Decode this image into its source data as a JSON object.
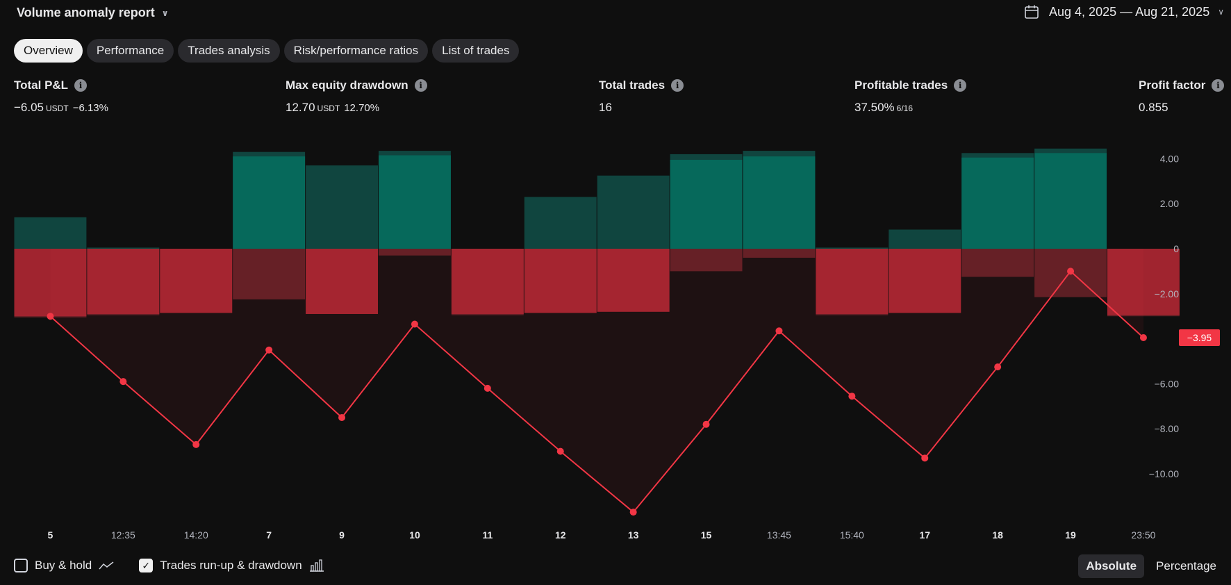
{
  "header": {
    "title": "Volume anomaly report",
    "date_range": "Aug 4, 2025 — Aug 21, 2025"
  },
  "tabs": [
    {
      "label": "Overview",
      "active": true
    },
    {
      "label": "Performance",
      "active": false
    },
    {
      "label": "Trades analysis",
      "active": false
    },
    {
      "label": "Risk/performance ratios",
      "active": false
    },
    {
      "label": "List of trades",
      "active": false
    }
  ],
  "metrics": {
    "total_pnl": {
      "label": "Total P&L",
      "value": "−6.05",
      "unit": "USDT",
      "pct": "−6.13%"
    },
    "max_drawdown": {
      "label": "Max equity drawdown",
      "value": "12.70",
      "unit": "USDT",
      "pct": "12.70%"
    },
    "total_trades": {
      "label": "Total trades",
      "value": "16"
    },
    "profitable": {
      "label": "Profitable trades",
      "value": "37.50%",
      "ratio": "6/16"
    },
    "profit_factor": {
      "label": "Profit factor",
      "value": "0.855"
    }
  },
  "colors": {
    "bg": "#0f0f0f",
    "negative": "#f23645",
    "runup_bright": "#06695b",
    "runup_dim": "#10453f",
    "drawdown_bright": "#a0242f",
    "drawdown_dim": "#5c1f24"
  },
  "chart_data": {
    "type": "line",
    "y_ticks": [
      "4.00",
      "2.00",
      "0",
      "−2.00",
      "−6.00",
      "−8.00",
      "−10.00"
    ],
    "y_tick_values": [
      4,
      2,
      0,
      -2,
      -6,
      -8,
      -10
    ],
    "ylim": [
      -12.7,
      5.0
    ],
    "categories": [
      "5",
      "12:35",
      "14:20",
      "7",
      "9",
      "10",
      "11",
      "12",
      "13",
      "15",
      "13:45",
      "15:40",
      "17",
      "18",
      "19",
      "23:50"
    ],
    "bold_categories": [
      "5",
      "7",
      "9",
      "10",
      "11",
      "12",
      "13",
      "15",
      "17",
      "18",
      "19"
    ],
    "equity": [
      -3.0,
      -5.9,
      -8.7,
      -4.5,
      -7.5,
      -3.35,
      -6.2,
      -9.0,
      -11.7,
      -7.8,
      -3.65,
      -6.55,
      -9.3,
      -5.25,
      -1.0,
      -3.95
    ],
    "last_value_label": "−3.95",
    "trade_pnl": [
      -3.0,
      -2.9,
      -2.85,
      4.1,
      -2.9,
      4.15,
      -2.9,
      -2.85,
      -2.8,
      3.95,
      4.1,
      -2.9,
      -2.85,
      4.05,
      4.25,
      -2.95
    ],
    "runup": [
      1.4,
      0.05,
      0,
      4.3,
      3.7,
      4.35,
      0,
      2.3,
      3.25,
      4.2,
      4.35,
      0.05,
      0.85,
      4.25,
      4.45,
      0
    ],
    "drawdown": [
      -3.05,
      -2.95,
      -2.85,
      -2.25,
      -2.9,
      -0.3,
      -2.95,
      -2.85,
      -2.8,
      -1.0,
      -0.4,
      -2.95,
      -2.85,
      -1.25,
      -2.15,
      -3.0
    ]
  },
  "legend": {
    "buy_hold": {
      "label": "Buy & hold",
      "checked": false
    },
    "runup_drawdown": {
      "label": "Trades run-up & drawdown",
      "checked": true
    }
  },
  "view_toggle": {
    "absolute": "Absolute",
    "percentage": "Percentage",
    "active": "absolute"
  }
}
